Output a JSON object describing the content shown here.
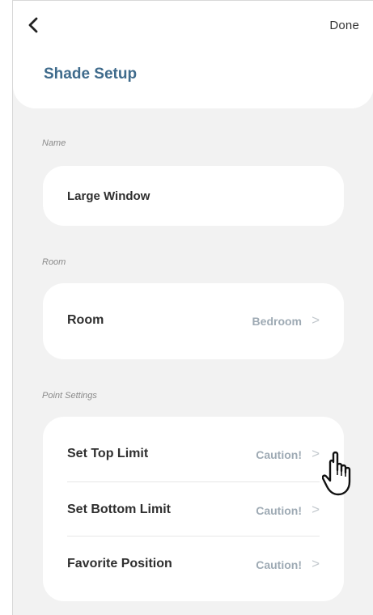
{
  "header": {
    "title": "Shade Setup",
    "done_label": "Done",
    "back_icon": "chevron-left-icon"
  },
  "name_section": {
    "label": "Name",
    "value": "Large Window"
  },
  "room_section": {
    "label": "Room",
    "row_label": "Room",
    "row_value": "Bedroom"
  },
  "point_section": {
    "label": "Point Settings",
    "rows": [
      {
        "label": "Set Top Limit",
        "value": "Caution!"
      },
      {
        "label": "Set Bottom Limit",
        "value": "Caution!"
      },
      {
        "label": "Favorite Position",
        "value": "Caution!"
      }
    ]
  },
  "colors": {
    "title": "#3f6b8c",
    "background": "#f2f2f2",
    "card": "#ffffff",
    "value_text": "#9eaab4"
  },
  "chevron_glyph": ">",
  "pointer": "hand-pointer-icon"
}
